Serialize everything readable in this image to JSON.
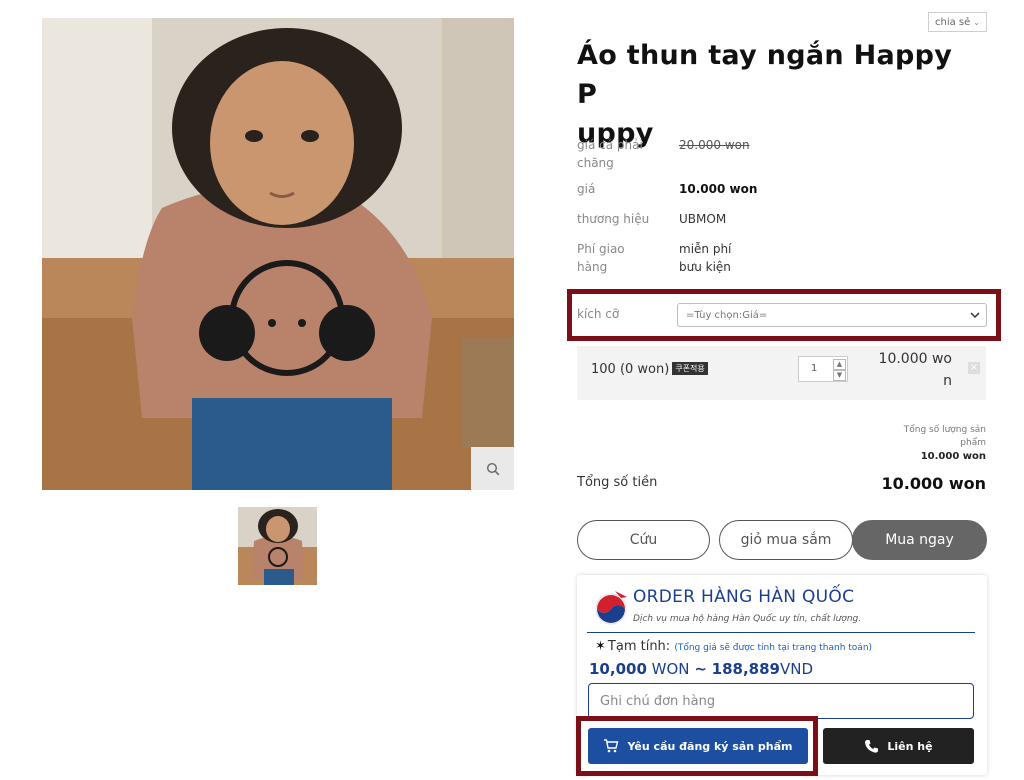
{
  "share": {
    "label": "chia sẻ",
    "caret": "⌄"
  },
  "product": {
    "title_line1": "Áo thun tay ngắn Happy P",
    "title_line2": "uppy"
  },
  "specs": {
    "retail_label_1": "giá cả phải",
    "retail_label_2": "chăng",
    "retail_value": "20.000 won",
    "price_label": "giá",
    "price_value": "10.000 won",
    "brand_label": "thương hiệu",
    "brand_value": "UBMOM",
    "shipping_label_1": "Phí giao",
    "shipping_label_2": "hàng",
    "shipping_value_1": "miễn phí",
    "shipping_value_2": "bưu kiện"
  },
  "size": {
    "label": "kích cỡ",
    "selected": "=Tùy chọn:Giá="
  },
  "option": {
    "name": "100 (0 won)",
    "coupon": "쿠폰적용",
    "quantity": "1",
    "price_line1": "10.000 wo",
    "price_line2": "n",
    "remove": "×"
  },
  "summary": {
    "qty_note_1": "Tổng số lượng sản",
    "qty_note_2": "phẩm",
    "qty_note_value": "10.000 won",
    "total_label": "Tổng số tiền",
    "total_value": "10.000 won"
  },
  "actions": {
    "wish": "Cứu",
    "cart": "giỏ mua sắm",
    "buy": "Mua ngay"
  },
  "order_widget": {
    "title": "ORDER HÀNG HÀN QUỐC",
    "subtitle": "Dịch vụ mua hộ hàng Hàn Quốc uy tín, chất lượng.",
    "estimate_label": "Tạm tính:",
    "estimate_note": "(Tổng giá sẽ được tính tại trang thanh toán)",
    "price_won_value": "10,000",
    "price_won_unit": "WON",
    "price_sep": "~",
    "price_vnd_value": "188,889",
    "price_vnd_unit": "VND",
    "note_placeholder": "Ghi chú đơn hàng",
    "request_button": "Yêu cầu đăng ký sản phẩm",
    "contact_button": "Liên hệ"
  },
  "colors": {
    "accent_blue": "#1c4fa0",
    "highlight_frame": "#7b0f18",
    "buy_button": "#666666"
  }
}
